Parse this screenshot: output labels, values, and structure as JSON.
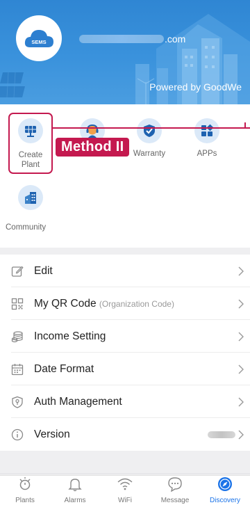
{
  "header": {
    "logo_text": "SEMS",
    "email_suffix": ".com",
    "powered_by": "Powered by GoodWe"
  },
  "tools": [
    {
      "label": "Create\nPlant",
      "icon": "solar-panel-icon"
    },
    {
      "label": "After-Sales",
      "icon": "support-agent-icon"
    },
    {
      "label": "Warranty",
      "icon": "shield-check-icon"
    },
    {
      "label": "APPs",
      "icon": "apps-grid-icon"
    },
    {
      "label": "Community",
      "icon": "community-building-icon"
    }
  ],
  "annotation": {
    "label": "Method II",
    "color": "#c4194f"
  },
  "menu": {
    "edit": "Edit",
    "qr": "My QR Code",
    "qr_sub": "(Organization Code)",
    "income": "Income Setting",
    "date": "Date Format",
    "auth": "Auth Management",
    "version": "Version"
  },
  "tabs": [
    {
      "label": "Plants",
      "icon": "plant-icon"
    },
    {
      "label": "Alarms",
      "icon": "bell-icon"
    },
    {
      "label": "WiFi",
      "icon": "wifi-icon"
    },
    {
      "label": "Message",
      "icon": "message-icon"
    },
    {
      "label": "Discovery",
      "icon": "compass-icon",
      "active": true
    }
  ],
  "colors": {
    "brand": "#2f86d3",
    "accent": "#1a73e8",
    "annotation": "#c4194f"
  }
}
